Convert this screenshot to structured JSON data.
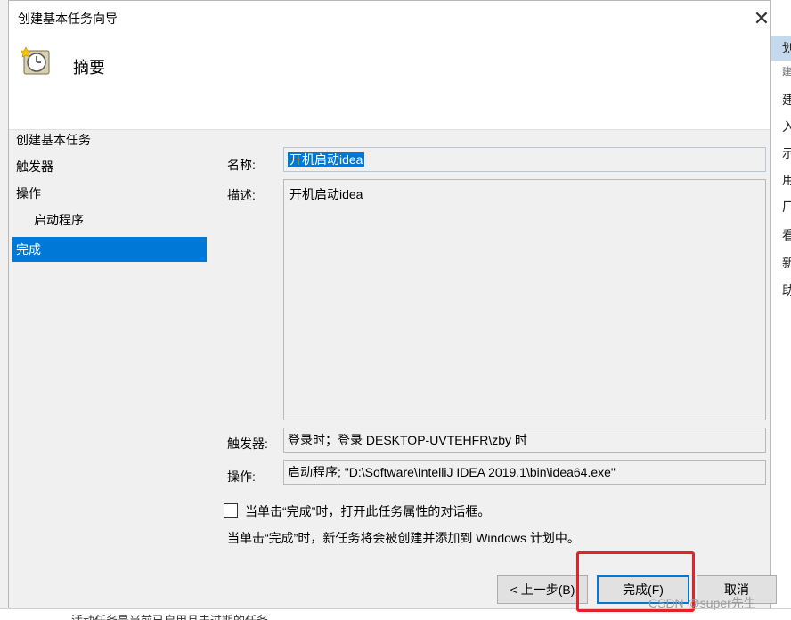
{
  "background_app": {
    "right_chars": [
      "划",
      "建",
      "建",
      "入",
      "示",
      "用",
      "厂",
      "看",
      "新",
      "助"
    ],
    "bottom_text": "活动任务是当前已启用且未过期的任务"
  },
  "dialog": {
    "title": "创建基本任务向导",
    "close_glyph": "✕",
    "header_title": "摘要"
  },
  "nav": {
    "items": [
      {
        "label": "创建基本任务"
      },
      {
        "label": "触发器"
      },
      {
        "label": "操作"
      },
      {
        "label": "启动程序"
      },
      {
        "label": "完成"
      }
    ]
  },
  "summary": {
    "name_label": "名称:",
    "name_value": "开机启动idea",
    "desc_label": "描述:",
    "desc_value": "开机启动idea",
    "trigger_label": "触发器:",
    "trigger_value": "登录时；登录 DESKTOP-UVTEHFR\\zby 时",
    "action_label": "操作:",
    "action_value": "启动程序; \"D:\\Software\\IntelliJ IDEA 2019.1\\bin\\idea64.exe\""
  },
  "open_properties": {
    "checked": false,
    "label": "当单击“完成”时，打开此任务属性的对话框。"
  },
  "info_text": "当单击“完成”时，新任务将会被创建并添加到 Windows 计划中。",
  "buttons": {
    "back": "< 上一步(B)",
    "finish": "完成(F)",
    "cancel": "取消"
  },
  "watermark": "CSDN @super先生",
  "colors": {
    "accent": "#0078d7",
    "highlight": "#e8202a"
  }
}
